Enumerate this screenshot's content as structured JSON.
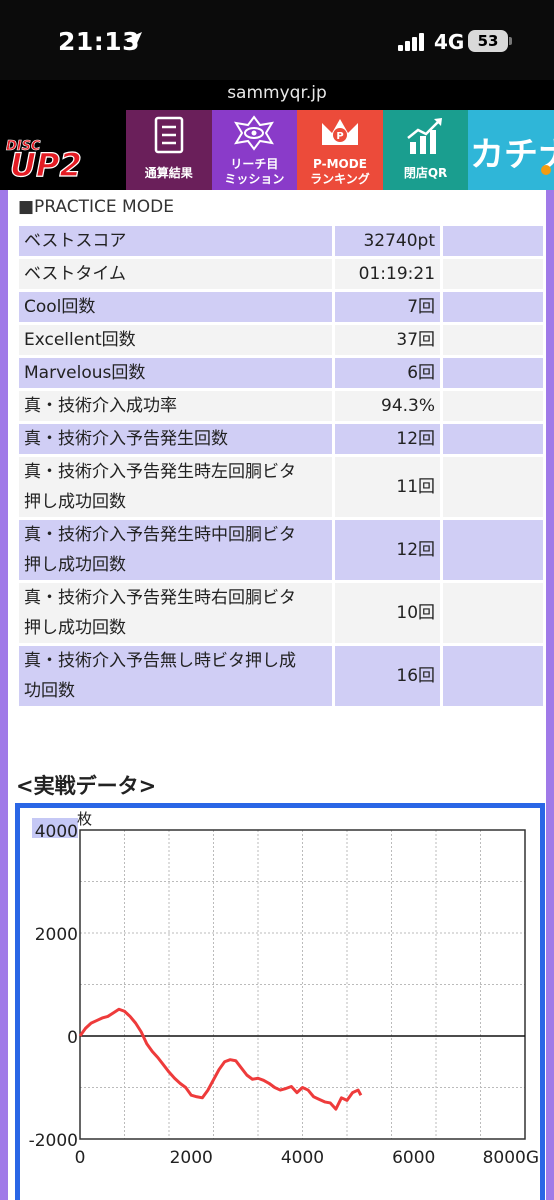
{
  "status_bar": {
    "time": "21:13",
    "network": "4G",
    "battery": "53"
  },
  "url": "sammyqr.jp",
  "nav": {
    "logo_top": "DISC",
    "logo_main": "UP2",
    "items": [
      {
        "label": "通算結果",
        "color": "#6a1f5a"
      },
      {
        "label_line1": "リーチ目",
        "label_line2": "ミッション",
        "color": "#8a3bc9"
      },
      {
        "label_line1": "P-MODE",
        "label_line2": "ランキング",
        "color": "#ec4b3a"
      },
      {
        "label": "閉店QR",
        "color": "#1a9e8f"
      }
    ],
    "last_label": "カチナビ"
  },
  "practice": {
    "title": "■PRACTICE MODE",
    "rows": [
      {
        "label": "ベストスコア",
        "value": "32740pt"
      },
      {
        "label": "ベストタイム",
        "value": "01:19:21"
      },
      {
        "label": "Cool回数",
        "value": "7回"
      },
      {
        "label": "Excellent回数",
        "value": "37回"
      },
      {
        "label": "Marvelous回数",
        "value": "6回"
      },
      {
        "label": "真・技術介入成功率",
        "value": "94.3%"
      },
      {
        "label": "真・技術介入予告発生回数",
        "value": "12回"
      },
      {
        "label_line1": "真・技術介入予告発生時左回胴ビタ",
        "label_line2": "押し成功回数",
        "value": "11回"
      },
      {
        "label_line1": "真・技術介入予告発生時中回胴ビタ",
        "label_line2": "押し成功回数",
        "value": "12回"
      },
      {
        "label_line1": "真・技術介入予告発生時右回胴ビタ",
        "label_line2": "押し成功回数",
        "value": "10回"
      },
      {
        "label_line1": "真・技術介入予告無し時ビタ押し成",
        "label_line2": "功回数",
        "value": "16回"
      }
    ]
  },
  "section_title": "<実戦データ>",
  "chart_data": {
    "type": "line",
    "ylabel": "枚",
    "ylim": [
      -2000,
      4000
    ],
    "xlim": [
      0,
      8000
    ],
    "y_ticks": [
      "4000",
      "2000",
      "0",
      "-2000"
    ],
    "x_ticks": [
      "0",
      "2000",
      "4000",
      "6000",
      "8000G"
    ],
    "grid": true,
    "line_color": "#ee3b3b",
    "series": [
      {
        "x": [
          0,
          100,
          200,
          300,
          400,
          500,
          600,
          700,
          800,
          900,
          1000,
          1100,
          1200,
          1300,
          1400,
          1500,
          1600,
          1700,
          1800,
          1900,
          2000,
          2100,
          2200,
          2300,
          2400,
          2500,
          2600,
          2700,
          2800,
          2900,
          3000,
          3100,
          3200,
          3300,
          3400,
          3500,
          3600,
          3700,
          3800,
          3900,
          4000,
          4100,
          4200,
          4300,
          4400,
          4500,
          4600,
          4700,
          4800,
          4900,
          5000,
          5050
        ],
        "y": [
          0,
          150,
          250,
          300,
          350,
          380,
          450,
          520,
          480,
          380,
          250,
          80,
          -150,
          -300,
          -420,
          -560,
          -700,
          -820,
          -920,
          -1000,
          -1150,
          -1180,
          -1200,
          -1050,
          -850,
          -650,
          -500,
          -460,
          -480,
          -620,
          -760,
          -840,
          -820,
          -860,
          -920,
          -1000,
          -1050,
          -1020,
          -980,
          -1100,
          -1000,
          -1050,
          -1180,
          -1230,
          -1280,
          -1300,
          -1420,
          -1200,
          -1250,
          -1100,
          -1050,
          -1150
        ]
      }
    ]
  }
}
